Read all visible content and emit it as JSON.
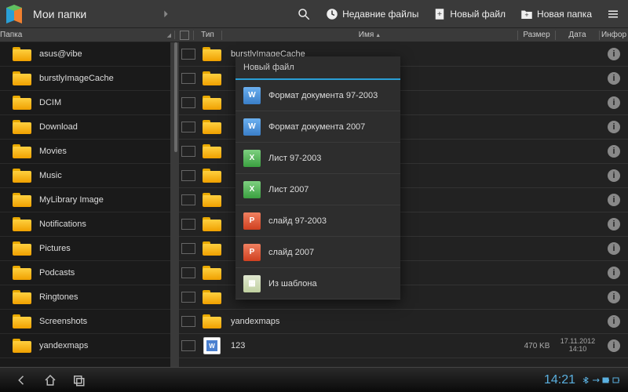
{
  "header": {
    "title": "Мои папки",
    "recent": "Недавние файлы",
    "new_file": "Новый файл",
    "new_folder": "Новая папка"
  },
  "columns": {
    "folder": "Папка",
    "type": "Тип",
    "name": "Имя",
    "size": "Размер",
    "date": "Дата",
    "info": "Инфор"
  },
  "sidebar": [
    "asus@vibe",
    "burstlyImageCache",
    "DCIM",
    "Download",
    "Movies",
    "Music",
    "MyLibrary Image",
    "Notifications",
    "Pictures",
    "Podcasts",
    "Ringtones",
    "Screenshots",
    "yandexmaps"
  ],
  "rows": [
    {
      "name": "burstlyImageCache",
      "type": "folder"
    },
    {
      "name": "",
      "type": "folder"
    },
    {
      "name": "",
      "type": "folder"
    },
    {
      "name": "",
      "type": "folder"
    },
    {
      "name": "",
      "type": "folder"
    },
    {
      "name": "",
      "type": "folder"
    },
    {
      "name": "",
      "type": "folder"
    },
    {
      "name": "",
      "type": "folder"
    },
    {
      "name": "",
      "type": "folder"
    },
    {
      "name": "",
      "type": "folder"
    },
    {
      "name": "",
      "type": "folder"
    },
    {
      "name": "yandexmaps",
      "type": "folder"
    },
    {
      "name": "123",
      "type": "word",
      "size": "470 KB",
      "date": "17.11.2012",
      "time": "14:10"
    }
  ],
  "popup": {
    "title": "Новый файл",
    "items": [
      {
        "icon": "w",
        "label": "Формат документа 97-2003"
      },
      {
        "icon": "w",
        "label": "Формат документа 2007"
      },
      {
        "icon": "x",
        "label": "Лист 97-2003"
      },
      {
        "icon": "x",
        "label": "Лист 2007"
      },
      {
        "icon": "p",
        "label": "слайд 97-2003"
      },
      {
        "icon": "p",
        "label": "слайд 2007"
      },
      {
        "icon": "t",
        "label": "Из шаблона"
      }
    ]
  },
  "statusbar": {
    "clock": "14:21"
  }
}
